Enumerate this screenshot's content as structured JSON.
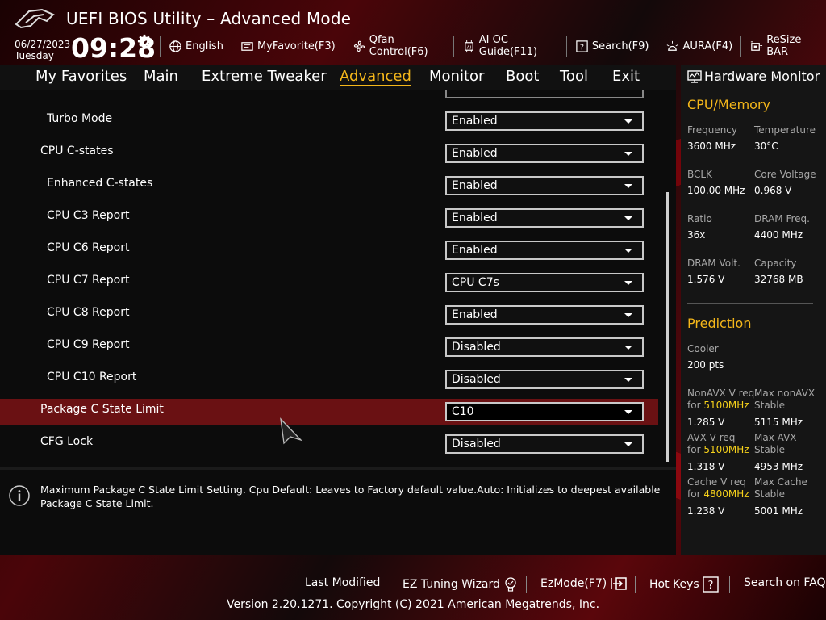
{
  "header": {
    "title": "UEFI BIOS Utility – Advanced Mode",
    "date": "06/27/2023",
    "day": "Tuesday",
    "time": "09:28",
    "toolbar": [
      {
        "label": "English",
        "icon": "globe-icon"
      },
      {
        "label": "MyFavorite(F3)",
        "icon": "favorite-icon"
      },
      {
        "label": "Qfan Control(F6)",
        "icon": "fan-icon"
      },
      {
        "label": "AI OC Guide(F11)",
        "icon": "ai-chip-icon"
      },
      {
        "label": "Search(F9)",
        "icon": "search-help-icon"
      },
      {
        "label": "AURA(F4)",
        "icon": "aura-light-icon"
      },
      {
        "label": "ReSize BAR",
        "icon": "resize-bar-icon"
      }
    ]
  },
  "nav": {
    "tabs": [
      "My Favorites",
      "Main",
      "Extreme Tweaker",
      "Advanced",
      "Monitor",
      "Boot",
      "Tool",
      "Exit"
    ],
    "active": "Advanced"
  },
  "settings": [
    {
      "label": "Turbo Mode",
      "value": "Enabled"
    },
    {
      "label": "CPU C-states",
      "value": "Enabled"
    },
    {
      "label": "Enhanced C-states",
      "value": "Enabled"
    },
    {
      "label": "CPU C3 Report",
      "value": "Enabled"
    },
    {
      "label": "CPU C6 Report",
      "value": "Enabled"
    },
    {
      "label": "CPU C7 Report",
      "value": "CPU C7s"
    },
    {
      "label": "CPU C8 Report",
      "value": "Enabled"
    },
    {
      "label": "CPU C9 Report",
      "value": "Disabled"
    },
    {
      "label": "CPU C10 Report",
      "value": "Disabled"
    },
    {
      "label": "Package C State Limit",
      "value": "C10"
    },
    {
      "label": "CFG Lock",
      "value": "Disabled"
    }
  ],
  "help": {
    "text": "Maximum Package C State Limit Setting. Cpu Default: Leaves to Factory default value.Auto: Initializes to deepest available Package C State Limit."
  },
  "hardware_monitor": {
    "title": "Hardware Monitor",
    "cpu_section": "CPU/Memory",
    "cpu": [
      {
        "label": "Frequency",
        "value": "3600 MHz"
      },
      {
        "label": "Temperature",
        "value": "30°C"
      },
      {
        "label": "BCLK",
        "value": "100.00 MHz"
      },
      {
        "label": "Core Voltage",
        "value": "0.968 V"
      },
      {
        "label": "Ratio",
        "value": "36x"
      },
      {
        "label": "DRAM Freq.",
        "value": "4400 MHz"
      },
      {
        "label": "DRAM Volt.",
        "value": "1.576 V"
      },
      {
        "label": "Capacity",
        "value": "32768 MB"
      }
    ],
    "prediction_section": "Prediction",
    "cooler_label": "Cooler",
    "cooler_value": "200 pts",
    "prediction": [
      {
        "label1": "NonAVX V req",
        "label2": "for",
        "freq": "5100MHz",
        "value": "1.285 V",
        "rlabel1": "Max nonAVX",
        "rlabel2": "Stable",
        "rvalue": "5115 MHz"
      },
      {
        "label1": "AVX V req",
        "label2": "for",
        "freq": "5100MHz",
        "value": "1.318 V",
        "rlabel1": "Max AVX",
        "rlabel2": "Stable",
        "rvalue": "4953 MHz"
      },
      {
        "label1": "Cache V req",
        "label2": "for",
        "freq": "4800MHz",
        "value": "1.238 V",
        "rlabel1": "Max Cache",
        "rlabel2": "Stable",
        "rvalue": "5001 MHz"
      }
    ]
  },
  "footer": {
    "last_modified": "Last Modified",
    "ez_tuning": "EZ Tuning Wizard",
    "ez_mode": "EzMode(F7)",
    "hot_keys": "Hot Keys",
    "search_faq": "Search on FAQ",
    "version": "Version 2.20.1271. Copyright (C) 2021 American Megatrends, Inc."
  },
  "colors": {
    "accent": "#f5b71a",
    "selected_row": "#6a1113",
    "highlight_freq": "#f5d01a"
  }
}
